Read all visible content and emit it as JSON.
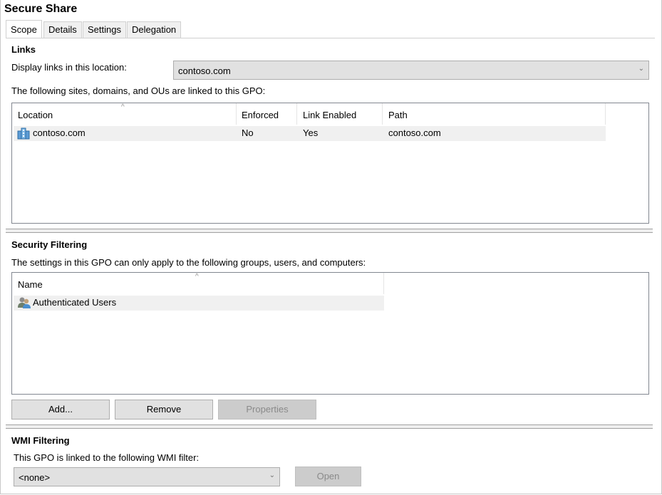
{
  "window": {
    "title": "Secure Share"
  },
  "tabs": [
    {
      "label": "Scope",
      "active": true
    },
    {
      "label": "Details",
      "active": false
    },
    {
      "label": "Settings",
      "active": false
    },
    {
      "label": "Delegation",
      "active": false
    }
  ],
  "links": {
    "section_title": "Links",
    "display_label": "Display links in this location:",
    "location_value": "contoso.com",
    "list_caption": "The following sites, domains, and OUs are linked to this GPO:",
    "columns": [
      "Location",
      "Enforced",
      "Link Enabled",
      "Path"
    ],
    "rows": [
      {
        "location": "contoso.com",
        "enforced": "No",
        "link_enabled": "Yes",
        "path": "contoso.com",
        "icon": "domain-icon"
      }
    ]
  },
  "security_filtering": {
    "section_title": "Security Filtering",
    "caption": "The settings in this GPO can only apply to the following groups, users, and computers:",
    "columns": [
      "Name"
    ],
    "rows": [
      {
        "name": "Authenticated Users",
        "icon": "user-group-icon"
      }
    ],
    "buttons": {
      "add": "Add...",
      "remove": "Remove",
      "properties": "Properties"
    }
  },
  "wmi_filtering": {
    "section_title": "WMI Filtering",
    "caption": "This GPO is linked to the following WMI filter:",
    "filter_value": "<none>",
    "open_button": "Open"
  },
  "colors": {
    "row_bg": "#f0f0f0",
    "button_bg": "#e1e1e1",
    "disabled_text": "#8a8a8a"
  }
}
